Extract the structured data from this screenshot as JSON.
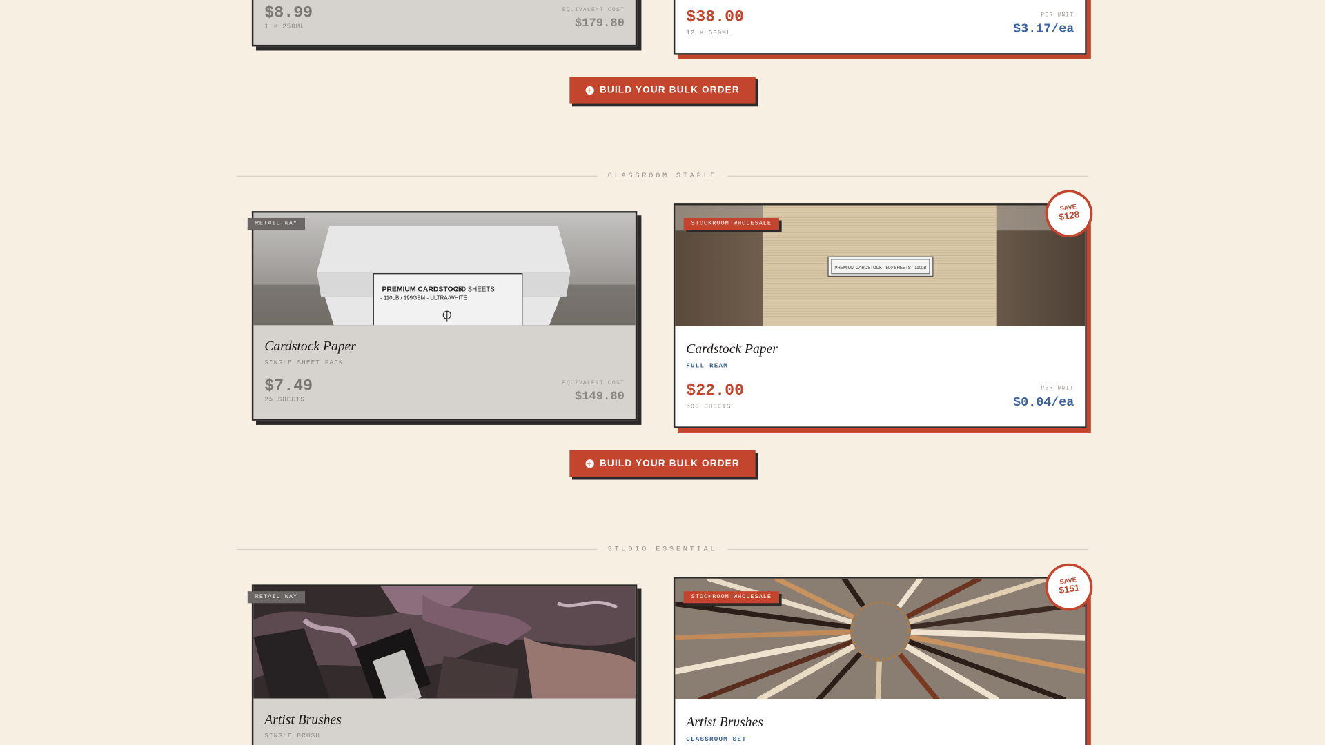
{
  "top": {
    "retail": {
      "price": "$8.99",
      "qty": "1 × 250ML",
      "eq_label": "EQUIVALENT COST",
      "eq_value": "$179.80"
    },
    "wholesale": {
      "price": "$38.00",
      "qty": "12 × 500ML",
      "eq_label": "PER UNIT",
      "eq_value": "$3.17/ea"
    }
  },
  "build_button": "BUILD YOUR BULK ORDER",
  "sections": [
    {
      "label": "CLASSROOM STAPLE",
      "retail": {
        "tag": "RETAIL WAY",
        "title": "Cardstock Paper",
        "sub": "SINGLE SHEET PACK",
        "price": "$7.49",
        "qty": "25 SHEETS",
        "eq_label": "EQUIVALENT COST",
        "eq_value": "$149.80",
        "label_line1": "PREMIUM CARDSTOCK",
        "label_line1b": " - 250 SHEETS",
        "label_line2": "- 110LB / 199GSM - ULTRA-WHITE"
      },
      "wholesale": {
        "tag": "STOCKROOM WHOLESALE",
        "title": "Cardstock Paper",
        "sub": "FULL REAM",
        "price": "$22.00",
        "qty": "500 SHEETS",
        "eq_label": "PER UNIT",
        "eq_value": "$0.04/ea",
        "save_label": "SAVE",
        "save_value": "$128",
        "label_text": "PREMIUM CARDSTOCK - 500 SHEETS - 110LB"
      }
    },
    {
      "label": "STUDIO ESSENTIAL",
      "retail": {
        "tag": "RETAIL WAY",
        "title": "Artist Brushes",
        "sub": "SINGLE BRUSH"
      },
      "wholesale": {
        "tag": "STOCKROOM WHOLESALE",
        "title": "Artist Brushes",
        "sub": "CLASSROOM SET",
        "save_label": "SAVE",
        "save_value": "$151"
      }
    }
  ]
}
